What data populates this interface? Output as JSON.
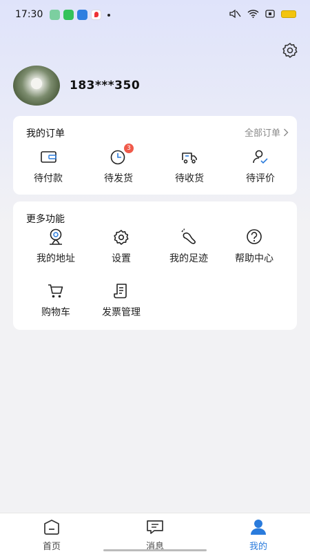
{
  "status_bar": {
    "time": "17:30",
    "battery_color": "#f3c40d"
  },
  "profile": {
    "username": "183***350"
  },
  "orders": {
    "title": "我的订单",
    "all_label": "全部订单",
    "items": [
      {
        "label": "待付款",
        "icon": "wallet-icon"
      },
      {
        "label": "待发货",
        "icon": "clock-icon",
        "badge": "3"
      },
      {
        "label": "待收货",
        "icon": "truck-icon"
      },
      {
        "label": "待评价",
        "icon": "user-check-icon"
      }
    ]
  },
  "more": {
    "title": "更多功能",
    "items": [
      {
        "label": "我的地址",
        "icon": "location-icon"
      },
      {
        "label": "设置",
        "icon": "gear-icon"
      },
      {
        "label": "我的足迹",
        "icon": "footprint-icon"
      },
      {
        "label": "帮助中心",
        "icon": "help-icon"
      },
      {
        "label": "购物车",
        "icon": "cart-icon"
      },
      {
        "label": "发票管理",
        "icon": "invoice-icon"
      }
    ]
  },
  "tabs": [
    {
      "label": "首页",
      "icon": "home-icon"
    },
    {
      "label": "消息",
      "icon": "message-icon"
    },
    {
      "label": "我的",
      "icon": "profile-icon",
      "active": true
    }
  ],
  "colors": {
    "accent": "#2a7bdc",
    "badge": "#f05a4a"
  }
}
